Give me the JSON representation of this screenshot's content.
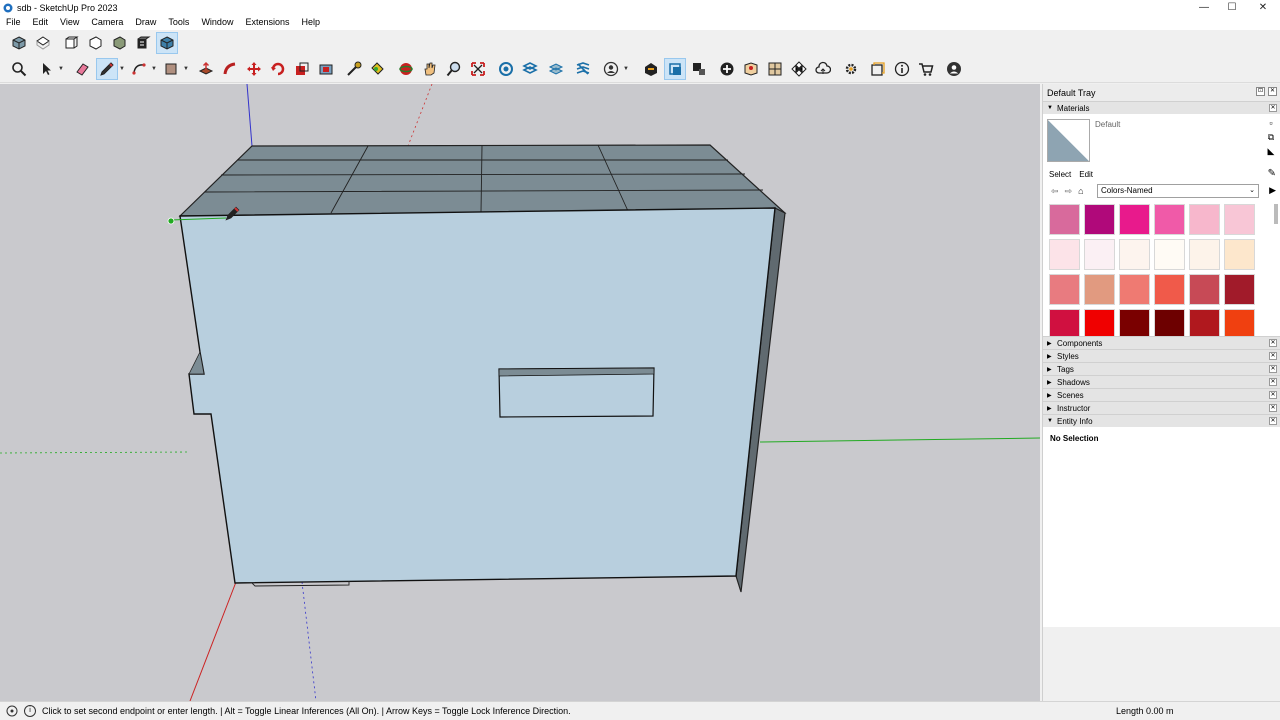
{
  "window": {
    "title": "sdb - SketchUp Pro 2023",
    "minimize": "—",
    "maximize": "☐",
    "close": "✕"
  },
  "menu": [
    "File",
    "Edit",
    "View",
    "Camera",
    "Draw",
    "Tools",
    "Window",
    "Extensions",
    "Help"
  ],
  "toolbar_views": [
    {
      "name": "iso-view-icon"
    },
    {
      "name": "top-view-icon"
    },
    {
      "name": "front-view-icon"
    },
    {
      "name": "right-view-icon"
    },
    {
      "name": "back-view-icon"
    },
    {
      "name": "left-view-icon"
    },
    {
      "name": "bottom-view-icon"
    }
  ],
  "tray": {
    "title": "Default Tray",
    "materials": {
      "panel_title": "Materials",
      "current_name": "Default",
      "tabs": [
        "Select",
        "Edit"
      ],
      "library": "Colors-Named",
      "swatches": [
        "#d86a9c",
        "#b0097a",
        "#e81a8c",
        "#f05aa8",
        "#f7b7cc",
        "#f8c6d6",
        "#fce3e8",
        "#fbf0f4",
        "#fdf4ee",
        "#fffbf5",
        "#fdf3ea",
        "#fde7cc",
        "#e87b80",
        "#e19a80",
        "#ef7a72",
        "#f05a4a",
        "#c74a56",
        "#a11b2a",
        "#d01040",
        "#f00000",
        "#7a0000",
        "#6d0000",
        "#b0181e",
        "#f04010"
      ]
    },
    "collapsed_panels": [
      "Components",
      "Styles",
      "Tags",
      "Shadows",
      "Scenes",
      "Instructor"
    ],
    "entity_info": {
      "panel_title": "Entity Info",
      "status": "No Selection"
    }
  },
  "statusbar": {
    "hint": "Click to set second endpoint or enter length. | Alt = Toggle Linear Inferences (All On). | Arrow Keys = Toggle Lock Inference Direction.",
    "length_label": "Length",
    "length_value": "0.00 m"
  },
  "colors": {
    "viewport_bg": "#c9c9cd",
    "front_face": "#b8cfde",
    "top_face": "#7c8c94",
    "side_face": "#606a70",
    "axis_red": "#cc2222",
    "axis_green": "#22aa22",
    "axis_blue": "#2222cc"
  }
}
